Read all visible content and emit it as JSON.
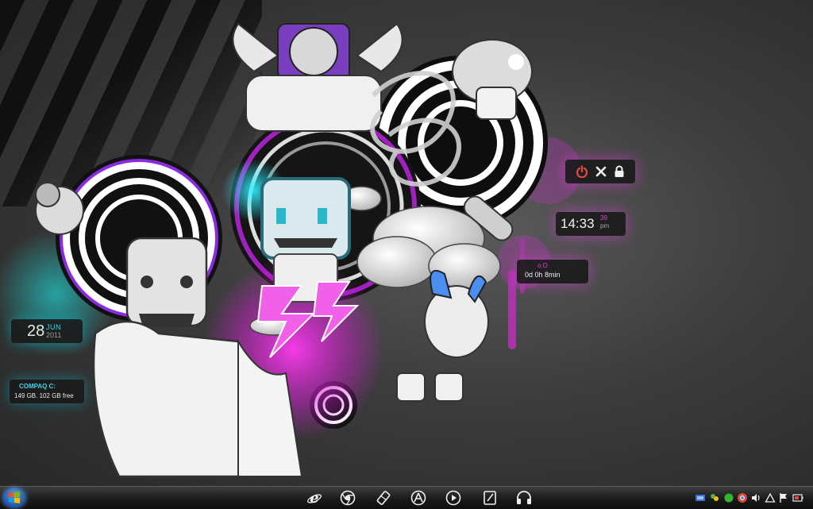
{
  "desktop": {
    "date_widget": {
      "day": "28",
      "month": "JUN",
      "year": "2011"
    },
    "drive_widget": {
      "name": "COMPAQ C:",
      "info": "149 GB. 102 GB free"
    },
    "power_widget": {
      "icons": [
        "power-icon",
        "close-icon",
        "lock-icon"
      ]
    },
    "clock_widget": {
      "time": "14:33",
      "seconds": "39",
      "ampm": "pm"
    },
    "uptime_widget": {
      "label": "o.O",
      "value": "0d 0h 8min"
    }
  },
  "taskbar": {
    "start_icon": "windows-logo-icon",
    "dock_icons": [
      "internet-explorer-icon",
      "chrome-icon",
      "paint-icon",
      "apps-icon",
      "media-player-icon",
      "notepad-icon",
      "headphones-icon"
    ],
    "tray_icons": [
      "network-icon",
      "messenger-icon",
      "status-icon",
      "chrome-tray-icon",
      "volume-icon",
      "tray-alert-icon",
      "flag-icon",
      "power-tray-icon"
    ]
  },
  "colors": {
    "accent_magenta": "#e640d8",
    "accent_cyan": "#3bd6e8",
    "accent_red": "#e24848"
  }
}
